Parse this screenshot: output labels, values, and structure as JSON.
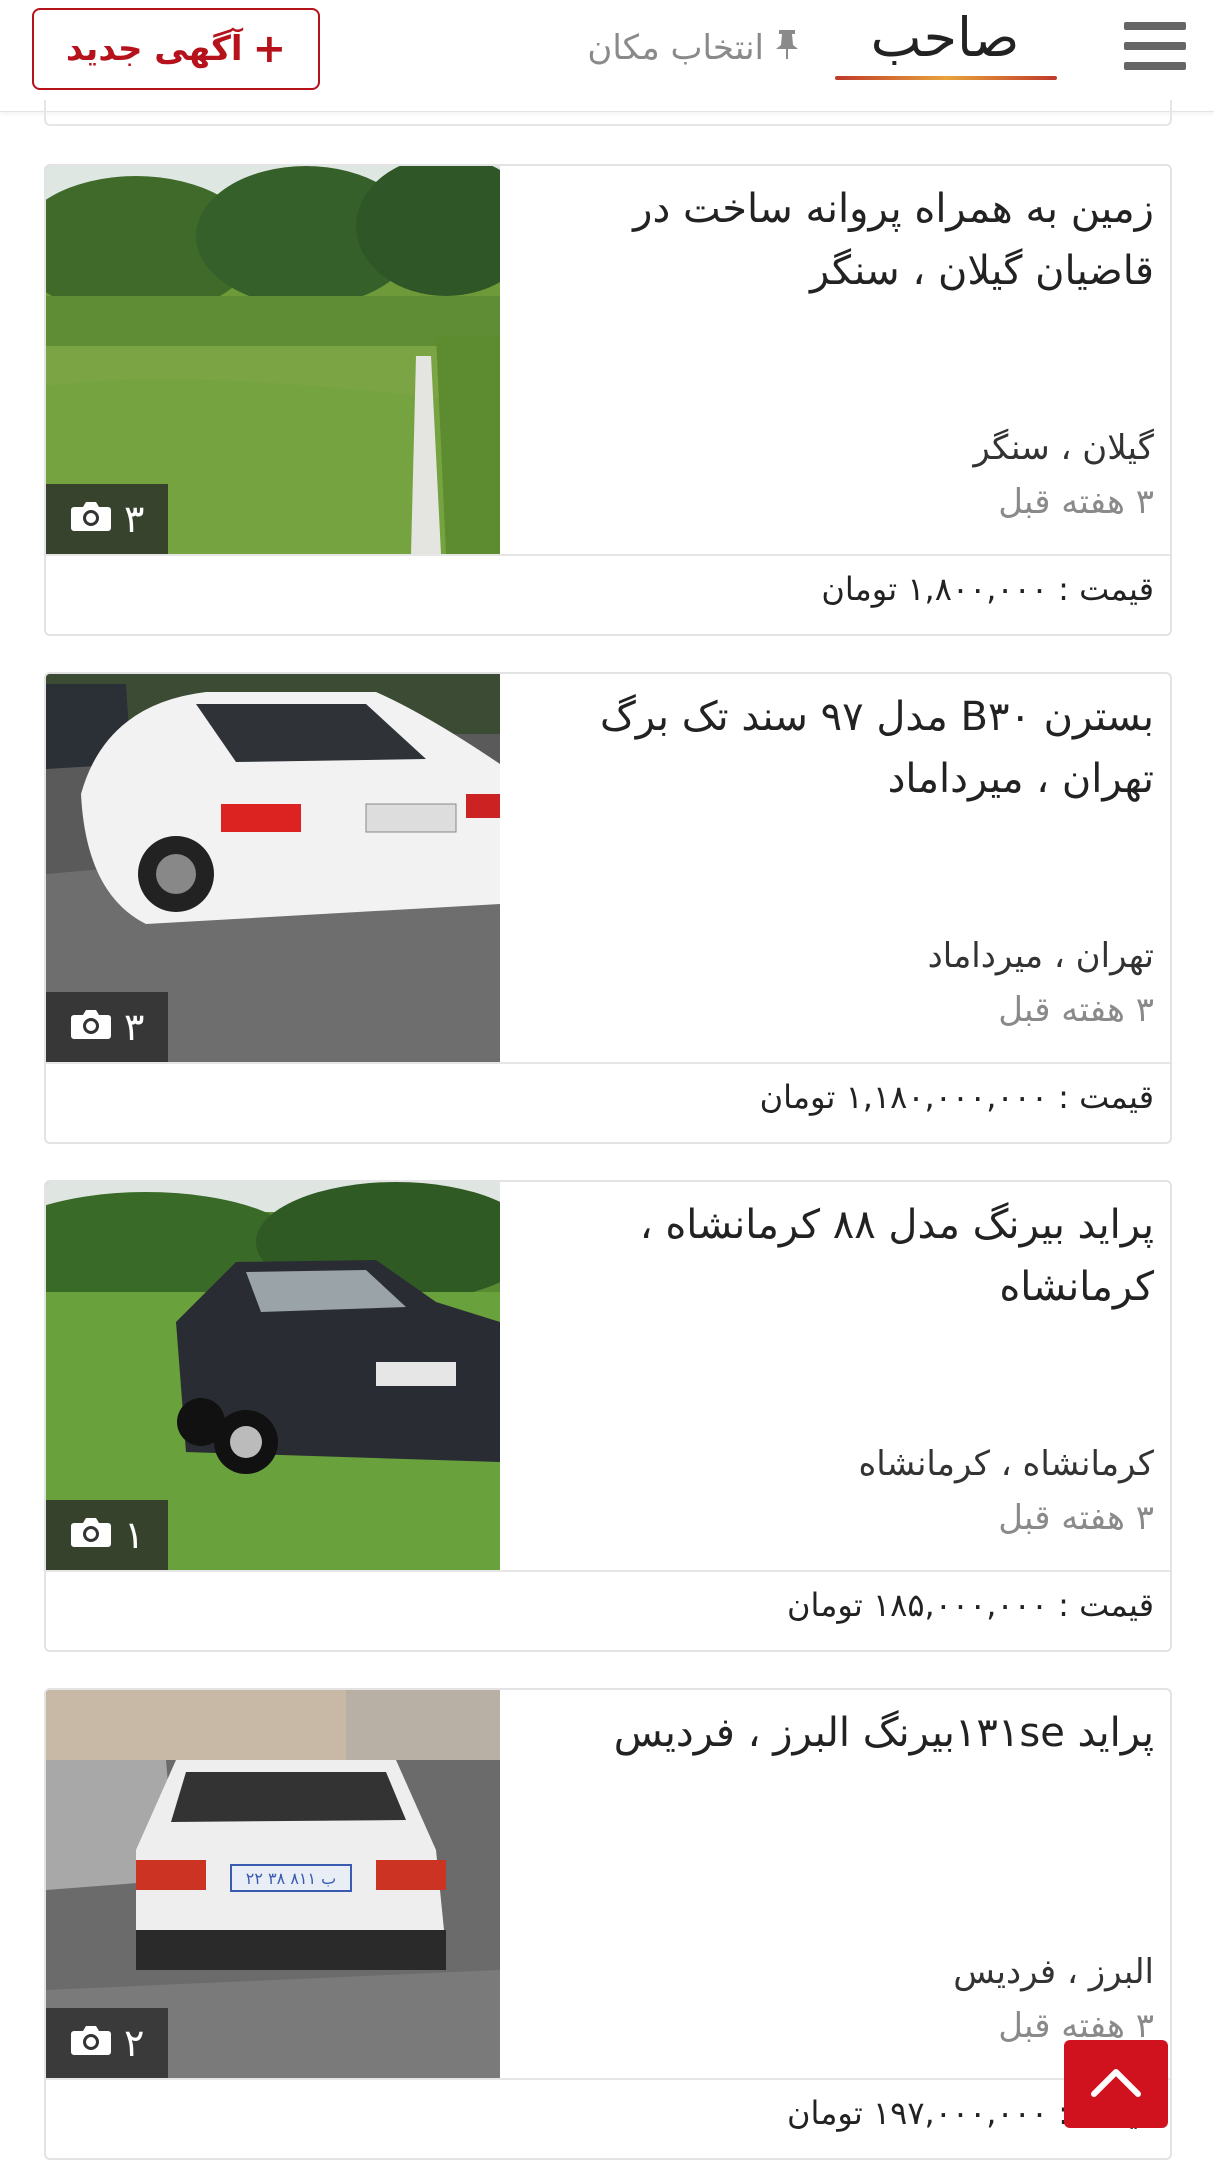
{
  "header": {
    "logo": "صاحب",
    "location_label": "انتخاب مکان",
    "new_ad_label": "آگهی جدید",
    "new_ad_plus": "+"
  },
  "listings": [
    {
      "title": "زمین به همراه پروانه ساخت در قاضیان گیلان ، سنگر",
      "location": "گیلان ، سنگر",
      "time": "۳ هفته قبل",
      "photo_count": "۳",
      "price": "قیمت : ۱,۸۰۰,۰۰۰ تومان"
    },
    {
      "title": "بسترن B۳۰ مدل ۹۷ سند تک برگ تهران ، میرداماد",
      "location": "تهران ، میرداماد",
      "time": "۳ هفته قبل",
      "photo_count": "۳",
      "price": "قیمت : ۱,۱۸۰,۰۰۰,۰۰۰ تومان"
    },
    {
      "title": "پراید بیرنگ مدل ۸۸ کرمانشاه ، کرمانشاه",
      "location": "کرمانشاه ، کرمانشاه",
      "time": "۳ هفته قبل",
      "photo_count": "۱",
      "price": "قیمت : ۱۸۵,۰۰۰,۰۰۰ تومان"
    },
    {
      "title": "پراید ۱۳۱seبیرنگ البرز ، فردیس",
      "location": "البرز ، فردیس",
      "time": "۳ هفته قبل",
      "photo_count": "۲",
      "price": "قیمت : ۱۹۷,۰۰۰,۰۰۰ تومان",
      "plate": "۲۲ ب ۸۱۱ ۳۸"
    }
  ],
  "colors": {
    "accent": "#d0121f",
    "button_border": "#b5121b",
    "muted_text": "#8a8a8a"
  },
  "icons": {
    "menu": "hamburger-icon",
    "pin": "pin-icon",
    "camera": "camera-icon",
    "scroll_top": "chevron-up-icon"
  }
}
